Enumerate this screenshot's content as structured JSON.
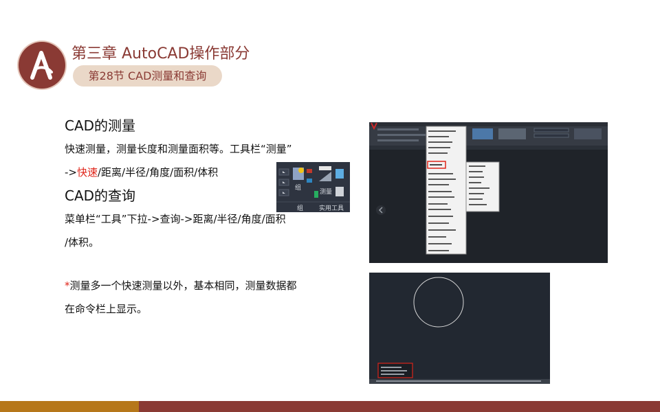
{
  "header": {
    "chapter_title": "第三章   AutoCAD操作部分",
    "section_label": "第28节 CAD测量和查询"
  },
  "content": {
    "measure_heading": "CAD的测量",
    "measure_line1": "快速测量，测量长度和测量面积等。工具栏“测量”",
    "measure_line2_prefix": "->",
    "measure_line2_highlight": "快速",
    "measure_line2_rest": "/距离/半径/角度/面积/体积",
    "query_heading": "CAD的查询",
    "query_line1": "菜单栏“工具”下拉->查询->距离/半径/角度/面积",
    "query_line2": "/体积。",
    "note_asterisk": "*",
    "note_line1": "测量多一个快速测量以外，基本相同，测量数据都",
    "note_line2": "在命令栏上显示。"
  },
  "toolbar_thumb": {
    "group_label": "组",
    "measure_label": "测量",
    "utilities_label": "实用工具"
  },
  "colors": {
    "brand": "#8a3a34",
    "pill_bg": "#ead8c8",
    "highlight": "#e0261b",
    "footer_left": "#b6771a",
    "footer_right": "#8a3a34"
  }
}
